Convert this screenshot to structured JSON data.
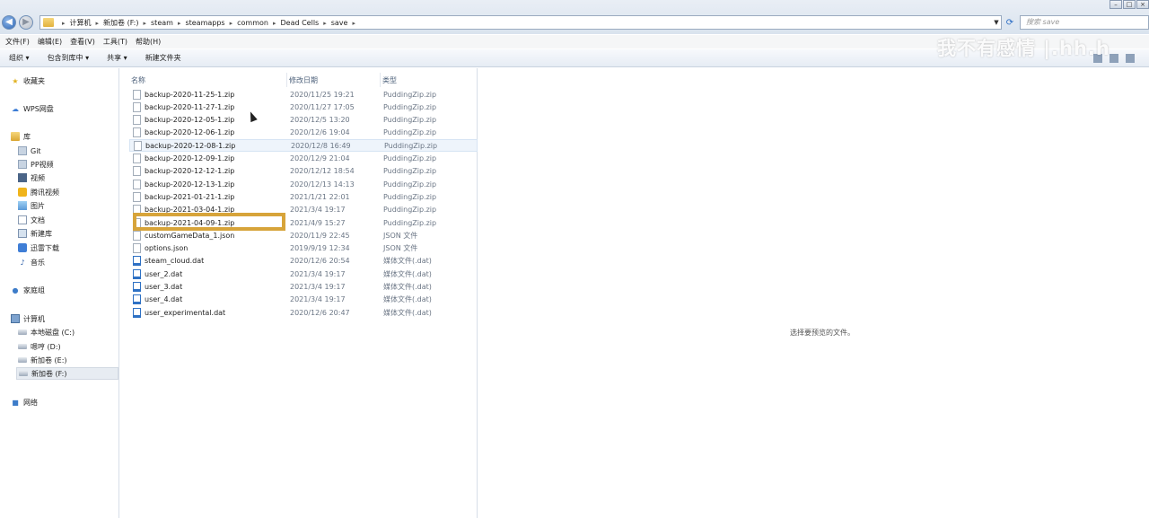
{
  "address": {
    "crumbs": [
      "计算机",
      "新加卷 (F:)",
      "steam",
      "steamapps",
      "common",
      "Dead Cells",
      "save"
    ],
    "search_placeholder": "搜索 save"
  },
  "watermark": "我不有感情 |.hh.h",
  "menu": [
    "文件(F)",
    "编辑(E)",
    "查看(V)",
    "工具(T)",
    "帮助(H)"
  ],
  "toolbar": [
    "组织 ▾",
    "包含到库中 ▾",
    "共享 ▾",
    "新建文件夹"
  ],
  "nav": {
    "favorites": "收藏夹",
    "wps": "WPS网盘",
    "library": "库",
    "library_items": [
      "Git",
      "PP视频",
      "视频",
      "腾讯视频",
      "图片",
      "文档",
      "新建库",
      "迅雷下载",
      "音乐"
    ],
    "homegroup": "家庭组",
    "computer": "计算机",
    "drives": [
      "本地磁盘 (C:)",
      "嗯哼 (D:)",
      "新加卷 (E:)",
      "新加卷 (F:)"
    ],
    "network": "网络"
  },
  "columns": {
    "name": "名称",
    "date": "修改日期",
    "type": "类型"
  },
  "files": [
    {
      "name": "backup-2020-11-25-1.zip",
      "date": "2020/11/25 19:21",
      "type": "PuddingZip.zip",
      "icon": "zip"
    },
    {
      "name": "backup-2020-11-27-1.zip",
      "date": "2020/11/27 17:05",
      "type": "PuddingZip.zip",
      "icon": "zip"
    },
    {
      "name": "backup-2020-12-05-1.zip",
      "date": "2020/12/5 13:20",
      "type": "PuddingZip.zip",
      "icon": "zip"
    },
    {
      "name": "backup-2020-12-06-1.zip",
      "date": "2020/12/6 19:04",
      "type": "PuddingZip.zip",
      "icon": "zip"
    },
    {
      "name": "backup-2020-12-08-1.zip",
      "date": "2020/12/8 16:49",
      "type": "PuddingZip.zip",
      "icon": "zip"
    },
    {
      "name": "backup-2020-12-09-1.zip",
      "date": "2020/12/9 21:04",
      "type": "PuddingZip.zip",
      "icon": "zip"
    },
    {
      "name": "backup-2020-12-12-1.zip",
      "date": "2020/12/12 18:54",
      "type": "PuddingZip.zip",
      "icon": "zip"
    },
    {
      "name": "backup-2020-12-13-1.zip",
      "date": "2020/12/13 14:13",
      "type": "PuddingZip.zip",
      "icon": "zip"
    },
    {
      "name": "backup-2021-01-21-1.zip",
      "date": "2021/1/21 22:01",
      "type": "PuddingZip.zip",
      "icon": "zip"
    },
    {
      "name": "backup-2021-03-04-1.zip",
      "date": "2021/3/4 19:17",
      "type": "PuddingZip.zip",
      "icon": "zip"
    },
    {
      "name": "backup-2021-04-09-1.zip",
      "date": "2021/4/9 15:27",
      "type": "PuddingZip.zip",
      "icon": "zip"
    },
    {
      "name": "customGameData_1.json",
      "date": "2020/11/9 22:45",
      "type": "JSON 文件",
      "icon": "doc"
    },
    {
      "name": "options.json",
      "date": "2019/9/19 12:34",
      "type": "JSON 文件",
      "icon": "doc"
    },
    {
      "name": "steam_cloud.dat",
      "date": "2020/12/6 20:54",
      "type": "媒体文件(.dat)",
      "icon": "media"
    },
    {
      "name": "user_2.dat",
      "date": "2021/3/4 19:17",
      "type": "媒体文件(.dat)",
      "icon": "media"
    },
    {
      "name": "user_3.dat",
      "date": "2021/3/4 19:17",
      "type": "媒体文件(.dat)",
      "icon": "media"
    },
    {
      "name": "user_4.dat",
      "date": "2021/3/4 19:17",
      "type": "媒体文件(.dat)",
      "icon": "media"
    },
    {
      "name": "user_experimental.dat",
      "date": "2020/12/6 20:47",
      "type": "媒体文件(.dat)",
      "icon": "media"
    }
  ],
  "preview": {
    "message": "选择要预览的文件。"
  },
  "colors": {
    "highlight": "#d7a43a"
  }
}
